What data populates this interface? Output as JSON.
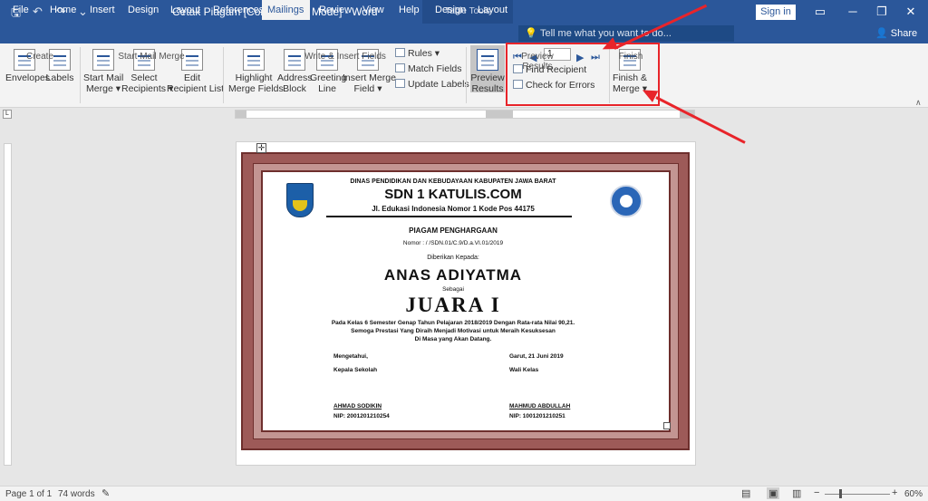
{
  "window": {
    "title": "Cetak Piagam [Compatibility Mode]  -  Word",
    "context_tab": "Table Tools",
    "signin": "Sign in",
    "share": "Share",
    "tellme": "Tell me what you want to do..."
  },
  "tabs": [
    "File",
    "Home",
    "Insert",
    "Design",
    "Layout",
    "References",
    "Mailings",
    "Review",
    "View",
    "Help",
    "Design",
    "Layout"
  ],
  "ribbon": {
    "envelopes": "Envelopes",
    "labels": "Labels",
    "create": "Create",
    "start_mail_merge": "Start Mail\nMerge ▾",
    "select_recipients": "Select\nRecipients ▾",
    "edit_recipient_list": "Edit\nRecipient List",
    "start_group": "Start Mail Merge",
    "highlight": "Highlight\nMerge Fields",
    "address_block": "Address\nBlock",
    "greeting_line": "Greeting\nLine",
    "insert_merge_field": "Insert Merge\nField ▾",
    "rules": "Rules ▾",
    "match_fields": "Match Fields",
    "update_labels": "Update Labels",
    "write_group": "Write & Insert Fields",
    "preview_results": "Preview\nResults",
    "record": "1",
    "find_recipient": "Find Recipient",
    "check_errors": "Check for Errors",
    "preview_group": "Preview Results",
    "finish_merge": "Finish &\nMerge ▾",
    "finish_group": "Finish"
  },
  "certificate": {
    "agency": "DINAS PENDIDIKAN DAN KEBUDAYAAN KABUPATEN JAWA BARAT",
    "school": "SDN 1 KATULIS.COM",
    "address": "Jl. Edukasi Indonesia Nomor 1 Kode Pos 44175",
    "heading": "PIAGAM PENGHARGAAN",
    "number": "Nomor :      /          /SDN.01/C.9/D.a.VI.01/2019",
    "given_to": "Diberikan Kepada:",
    "name": "ANAS ADIYATMA",
    "as": "Sebagai",
    "rank": "JUARA I",
    "line1": "Pada Kelas 6 Semester Genap Tahun Pelajaran 2018/2019 Dengan Rata-rata Nilai 90,21.",
    "line2": "Semoga Prestasi Yang Diraih Menjadi Motivasi untuk Meraih Kesuksesan",
    "line3": "Di Masa yang Akan Datang.",
    "left_label1": "Mengetahui,",
    "left_label2": "Kepala Sekolah",
    "right_label1": "Garut, 21 Juni 2019",
    "right_label2": "Wali Kelas",
    "left_name": "AHMAD SODIKIN",
    "left_nip": "NIP: 2001201210254",
    "right_name": "MAHMUD ABDULLAH",
    "right_nip": "NIP: 1001201210251"
  },
  "status": {
    "page": "Page 1 of 1",
    "words": "74 words",
    "zoom": "60%"
  }
}
